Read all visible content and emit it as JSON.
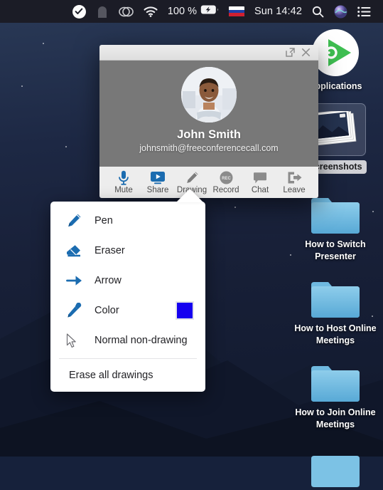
{
  "menubar": {
    "icons": [
      {
        "name": "check-badge-icon",
        "label": "check-badge"
      },
      {
        "name": "lock-icon",
        "label": "lock"
      },
      {
        "name": "creative-cloud-icon",
        "label": "creative-cloud"
      },
      {
        "name": "wifi-icon",
        "label": "wifi"
      }
    ],
    "battery_percent": "100 %",
    "battery_icon": "battery-charging-icon",
    "flag_icon": "russia-flag-icon",
    "clock": "Sun 14:42",
    "search_icon": "search-icon",
    "siri_icon": "siri-icon",
    "controlcenter_icon": "list-icon"
  },
  "desktop": {
    "icons": [
      {
        "label": "Applications",
        "glyph": "green-play-icon",
        "selected": false,
        "type": "app"
      },
      {
        "label": "Screenshots",
        "glyph": "photo-stack-icon",
        "selected": true,
        "type": "screenshots"
      },
      {
        "label": "How to Switch Presenter",
        "glyph": "folder-icon",
        "selected": false,
        "type": "folder"
      },
      {
        "label": "How to Host Online Meetings",
        "glyph": "folder-icon",
        "selected": false,
        "type": "folder"
      },
      {
        "label": "How to Join Online Meetings",
        "glyph": "folder-icon",
        "selected": false,
        "type": "folder"
      }
    ]
  },
  "call_window": {
    "title": "",
    "expand_icon": "expand-icon",
    "close_icon": "close-icon",
    "participant": {
      "name": "John Smith",
      "email": "johnsmith@freeconferencecall.com",
      "avatar_icon": "user-photo-avatar"
    },
    "toolbar": [
      {
        "label": "Mute",
        "icon": "microphone-icon",
        "active": true
      },
      {
        "label": "Share",
        "icon": "screen-share-icon",
        "active": true
      },
      {
        "label": "Drawing",
        "icon": "pencil-icon",
        "active": false
      },
      {
        "label": "Record",
        "icon": "record-icon",
        "active": false
      },
      {
        "label": "Chat",
        "icon": "chat-bubble-icon",
        "active": false
      },
      {
        "label": "Leave",
        "icon": "exit-icon",
        "active": false
      }
    ]
  },
  "drawing_menu": {
    "items": [
      {
        "label": "Pen",
        "icon": "pen-icon"
      },
      {
        "label": "Eraser",
        "icon": "eraser-icon"
      },
      {
        "label": "Arrow",
        "icon": "arrow-icon"
      },
      {
        "label": "Color",
        "icon": "eyedropper-icon",
        "swatch": "#1500F0"
      },
      {
        "label": "Normal non-drawing",
        "icon": "cursor-icon"
      }
    ],
    "erase_all_label": "Erase all drawings"
  },
  "colors": {
    "accent_blue": "#1B6CB0",
    "swatch_blue": "#1500F0",
    "window_gray": "#787878",
    "toolbar_gray": "#ededed",
    "menubar_dark": "#1b1c26"
  }
}
